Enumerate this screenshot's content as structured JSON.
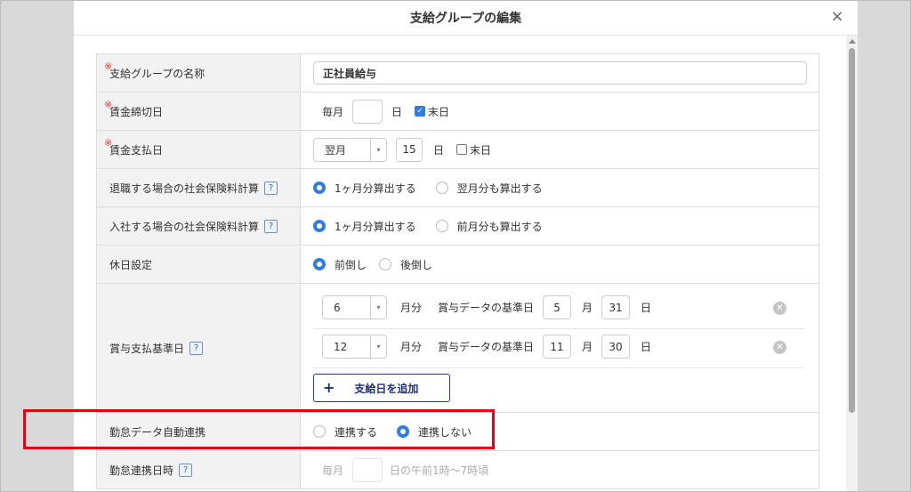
{
  "modal": {
    "title": "支給グループの編集",
    "close_label": "×"
  },
  "rows": {
    "name": {
      "label": "支給グループの名称",
      "required": "※",
      "value": "正社員給与"
    },
    "cutoff": {
      "label": "賃金締切日",
      "required": "※",
      "prefix": "毎月",
      "day_value": "",
      "day_unit": "日",
      "last_day_label": "末日",
      "last_day_checked": true
    },
    "payday": {
      "label": "賃金支払日",
      "required": "※",
      "month_value": "翌月",
      "day_value": "15",
      "day_unit": "日",
      "last_day_label": "末日",
      "last_day_checked": false
    },
    "retire_insurance": {
      "label": "退職する場合の社会保険料計算",
      "help": "?",
      "opt1": "1ヶ月分算出する",
      "opt2": "翌月分も算出する",
      "selected": 1
    },
    "join_insurance": {
      "label": "入社する場合の社会保険料計算",
      "help": "?",
      "opt1": "1ヶ月分算出する",
      "opt2": "前月分も算出する",
      "selected": 1
    },
    "holiday": {
      "label": "休日設定",
      "opt1": "前倒し",
      "opt2": "後倒し",
      "selected": 1
    },
    "bonus": {
      "label": "賞与支払基準日",
      "help": "?",
      "entries": [
        {
          "month": "6",
          "month_unit": "月分",
          "base_label": "賞与データの基準日",
          "base_month": "5",
          "month_suffix": "月",
          "base_day": "31",
          "day_suffix": "日"
        },
        {
          "month": "12",
          "month_unit": "月分",
          "base_label": "賞与データの基準日",
          "base_month": "11",
          "month_suffix": "月",
          "base_day": "30",
          "day_suffix": "日"
        }
      ],
      "add_label": "支給日を追加"
    },
    "attendance_link": {
      "label": "勤怠データ自動連携",
      "opt1": "連携する",
      "opt2": "連携しない",
      "selected": 2
    },
    "attendance_time": {
      "label": "勤怠連携日時",
      "help": "?",
      "prefix": "毎月",
      "suffix": "日の午前1時〜7時頃"
    }
  },
  "colors": {
    "accent": "#2f7de1",
    "highlight": "#e60012",
    "required": "#e53935"
  }
}
